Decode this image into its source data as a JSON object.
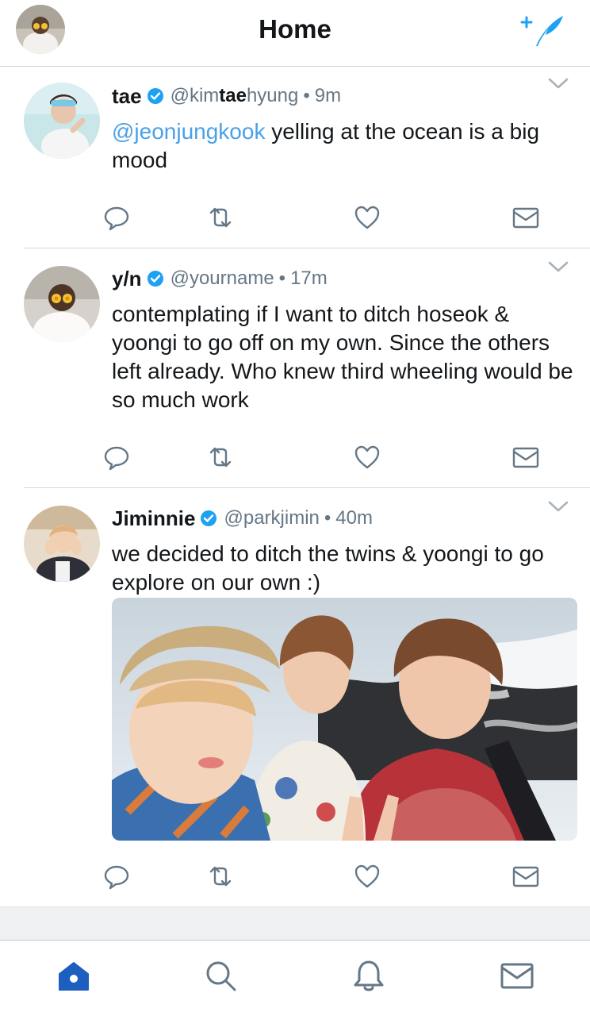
{
  "header": {
    "title": "Home",
    "compose_icon": "compose-quill-icon"
  },
  "colors": {
    "accent": "#1da1f2",
    "mention": "#4aa1e8",
    "secondary_text": "#657786",
    "tab_home_active": "#1d5fbf"
  },
  "tweets": [
    {
      "name": "tae",
      "handle_pre": "@kim",
      "handle_bold": "tae",
      "handle_post": "hyung",
      "time": "9m",
      "mention": "@jeonjungkook",
      "text": " yelling at the ocean is a big mood"
    },
    {
      "name": "y/n",
      "handle": "@yourname",
      "time": "17m",
      "text": "contemplating if I want to ditch hoseok & yoongi to go off on my own. Since the others left already. Who knew third wheeling would be so much work"
    },
    {
      "name": "Jiminnie",
      "handle": "@parkjimin",
      "time": "40m",
      "text": "we decided to ditch the twins & yoongi to go explore on our own :)",
      "media_icon": "selfie-photo"
    }
  ],
  "separator": "•",
  "actions": [
    "reply-icon",
    "retweet-icon",
    "like-icon",
    "direct-message-icon"
  ],
  "tabs": [
    "home-icon",
    "search-icon",
    "notifications-bell-icon",
    "messages-envelope-icon"
  ]
}
